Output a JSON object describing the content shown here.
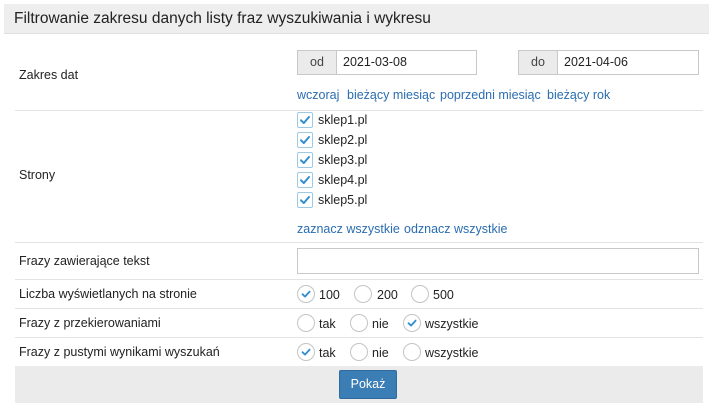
{
  "header": {
    "title": "Filtrowanie zakresu danych listy fraz wyszukiwania i wykresu"
  },
  "dates": {
    "label": "Zakres dat",
    "from_label": "od",
    "from_value": "2021-03-08",
    "to_label": "do",
    "to_value": "2021-04-06",
    "quick_links": [
      "wczoraj",
      "bieżący miesiąc",
      "poprzedni miesiąc",
      "bieżący rok"
    ]
  },
  "sites": {
    "label": "Strony",
    "items": [
      {
        "name": "sklep1.pl",
        "checked": true
      },
      {
        "name": "sklep2.pl",
        "checked": true
      },
      {
        "name": "sklep3.pl",
        "checked": true
      },
      {
        "name": "sklep4.pl",
        "checked": true
      },
      {
        "name": "sklep5.pl",
        "checked": true
      }
    ],
    "select_all": "zaznacz wszystkie",
    "deselect_all": "odznacz wszystkie"
  },
  "text_filter": {
    "label": "Frazy zawierające tekst",
    "value": ""
  },
  "per_page": {
    "label": "Liczba wyświetlanych na stronie",
    "options": [
      "100",
      "200",
      "500"
    ],
    "selected": "100"
  },
  "redirects": {
    "label": "Frazy z przekierowaniami",
    "options": [
      "tak",
      "nie",
      "wszystkie"
    ],
    "selected": "wszystkie"
  },
  "empty_results": {
    "label": "Frazy z pustymi wynikami wyszukań",
    "options": [
      "tak",
      "nie",
      "wszystkie"
    ],
    "selected": "tak"
  },
  "submit": {
    "label": "Pokaż"
  },
  "colors": {
    "accent": "#3b7db5",
    "link": "#2a6db0",
    "check": "#2f8fd0"
  }
}
